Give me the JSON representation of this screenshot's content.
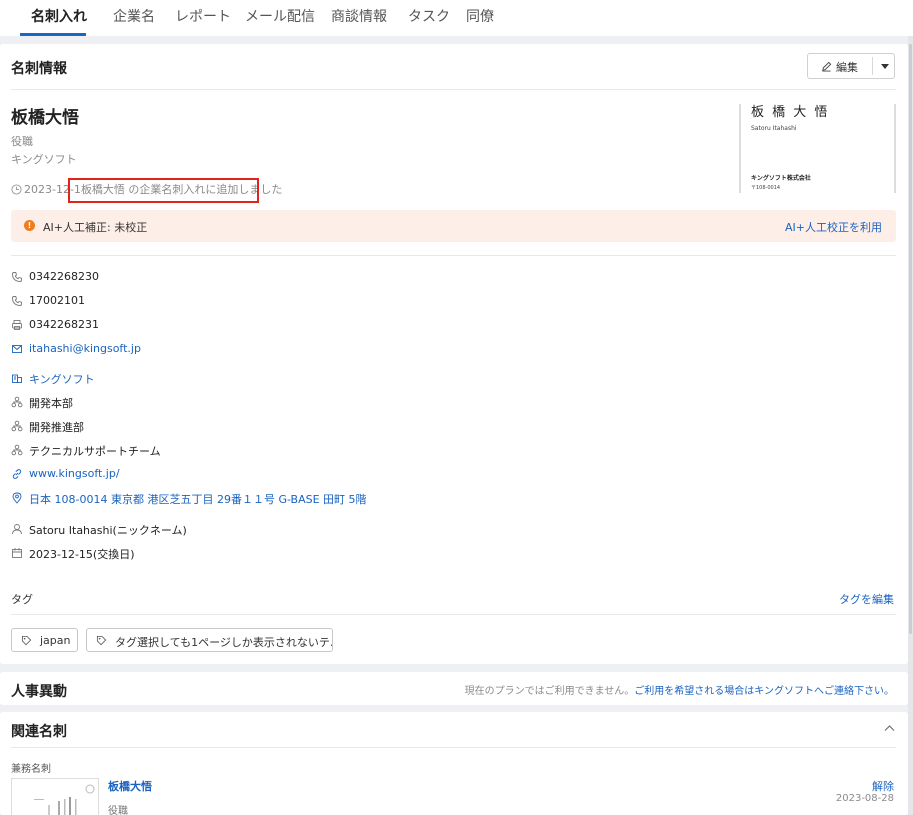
{
  "tabs": [
    {
      "label": "名刺入れ",
      "active": true
    },
    {
      "label": "企業名"
    },
    {
      "label": "レポート"
    },
    {
      "label": "メール配信"
    },
    {
      "label": "商談情報"
    },
    {
      "label": "タスク"
    },
    {
      "label": "同僚"
    }
  ],
  "card_info": {
    "title": "名刺情報",
    "edit_label": "編集",
    "name": "板橋大悟",
    "role": "役職",
    "company": "キングソフト",
    "history_date": "2023-12-1",
    "history_text": "板橋大悟 の企業名刺入れに追加しました",
    "thumb": {
      "name": "板 橋  大 悟",
      "roman": "Satoru Itahashi",
      "company": "キングソフト株式会社",
      "postal": "〒108-0014"
    },
    "ai_bar": {
      "status": "AI+人工補正: 未校正",
      "link": "AI+人工校正を利用"
    },
    "fields": {
      "phone": "0342268230",
      "mobile": "17002101",
      "fax": "0342268231",
      "email": "itahashi@kingsoft.jp",
      "company": "キングソフト",
      "dept1": "開発本部",
      "dept2": "開発推進部",
      "dept3": "テクニカルサポートチーム",
      "website": "www.kingsoft.jp/",
      "address": "日本 108-0014 東京都 港区芝五丁目 29番１１号 G-BASE 田町 5階",
      "nickname": "Satoru Itahashi(ニックネーム)",
      "exchange_date": "2023-12-15(交換日)"
    },
    "tags_label": "タグ",
    "tags_edit": "タグを編集",
    "tags": [
      "japan",
      "タグ選択しても1ページしか表示されないテ…"
    ]
  },
  "jinji": {
    "title": "人事異動",
    "note": "現在のプランではご利用できません。",
    "note_link": "ご利用を希望される場合はキングソフトへご連絡下さい。"
  },
  "related": {
    "title": "関連名刺",
    "sub_label": "兼務名刺",
    "item_name": "板橋大悟",
    "item_role": "役職",
    "unlink": "解除",
    "date": "2023-08-28"
  },
  "colors": {
    "accent": "#1a63c0",
    "warning": "#f07c1b",
    "highlight_box": "#e0231c",
    "ai_bar_bg": "#fdeee7"
  }
}
